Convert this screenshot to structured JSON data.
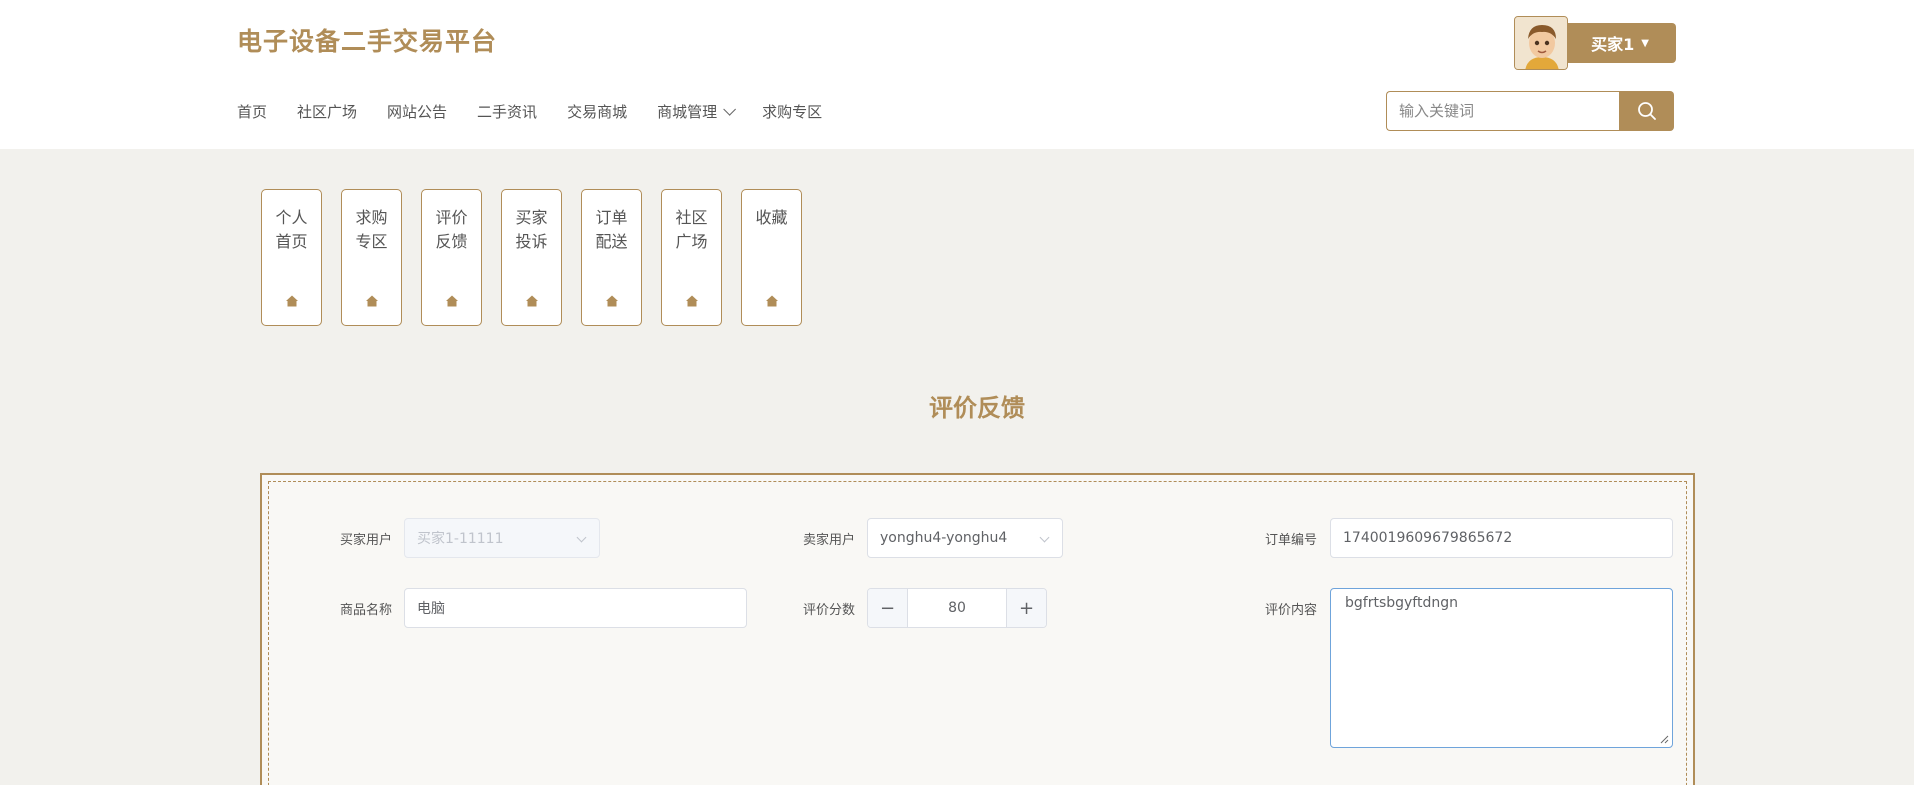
{
  "header": {
    "site_title": "电子设备二手交易平台",
    "user_name": "买家1",
    "nav": [
      "首页",
      "社区广场",
      "网站公告",
      "二手资讯",
      "交易商城",
      "商城管理",
      "求购专区"
    ],
    "search_placeholder": "输入关键词"
  },
  "cards": [
    {
      "label": "个人首页"
    },
    {
      "label": "求购专区"
    },
    {
      "label": "评价反馈"
    },
    {
      "label": "买家投诉"
    },
    {
      "label": "订单配送"
    },
    {
      "label": "社区广场"
    },
    {
      "label": "收藏"
    }
  ],
  "section_title": "评价反馈",
  "form": {
    "buyer_label": "买家用户",
    "buyer_value": "买家1-11111",
    "seller_label": "卖家用户",
    "seller_value": "yonghu4-yonghu4",
    "order_label": "订单编号",
    "order_value": "1740019609679865672",
    "product_label": "商品名称",
    "product_value": "电脑",
    "score_label": "评价分数",
    "score_value": "80",
    "content_label": "评价内容",
    "content_value": "bgfrtsbgyftdngn"
  },
  "colors": {
    "accent": "#b08d58",
    "focus": "#6fa4db"
  }
}
